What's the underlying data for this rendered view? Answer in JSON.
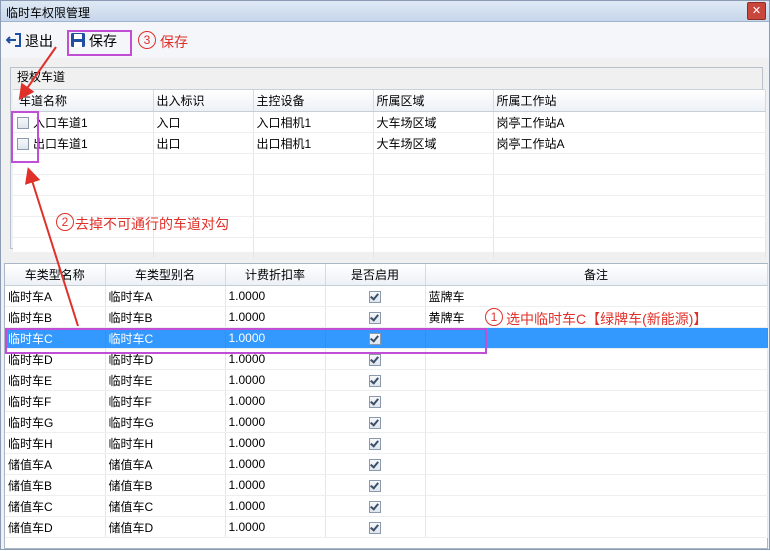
{
  "window": {
    "title": "临时车权限管理",
    "close_label": "✕"
  },
  "toolbar": {
    "exit_label": "退出",
    "save_label": "保存"
  },
  "annotations": {
    "step1_num": "1",
    "step1_text": "选中临时车C【绿牌车(新能源)】",
    "step2_num": "2",
    "step2_text": "去掉不可通行的车道对勾",
    "step3_num": "3",
    "step3_text": "保存"
  },
  "lanes": {
    "group_title": "授权车道",
    "columns": [
      "车道名称",
      "出入标识",
      "主控设备",
      "所属区域",
      "所属工作站"
    ],
    "rows": [
      {
        "checked": false,
        "name": "入口车道1",
        "direction": "入口",
        "device": "入口相机1",
        "area": "大车场区域",
        "station": "岗亭工作站A"
      },
      {
        "checked": false,
        "name": "出口车道1",
        "direction": "出口",
        "device": "出口相机1",
        "area": "大车场区域",
        "station": "岗亭工作站A"
      }
    ]
  },
  "car_types": {
    "columns": [
      "车类型名称",
      "车类型别名",
      "计费折扣率",
      "是否启用",
      "备注"
    ],
    "selected_index": 2,
    "rows": [
      {
        "name": "临时车A",
        "alias": "临时车A",
        "rate": "1.0000",
        "enabled": true,
        "note": "蓝牌车"
      },
      {
        "name": "临时车B",
        "alias": "临时车B",
        "rate": "1.0000",
        "enabled": true,
        "note": "黄牌车"
      },
      {
        "name": "临时车C",
        "alias": "临时车C",
        "rate": "1.0000",
        "enabled": true,
        "note": ""
      },
      {
        "name": "临时车D",
        "alias": "临时车D",
        "rate": "1.0000",
        "enabled": true,
        "note": ""
      },
      {
        "name": "临时车E",
        "alias": "临时车E",
        "rate": "1.0000",
        "enabled": true,
        "note": ""
      },
      {
        "name": "临时车F",
        "alias": "临时车F",
        "rate": "1.0000",
        "enabled": true,
        "note": ""
      },
      {
        "name": "临时车G",
        "alias": "临时车G",
        "rate": "1.0000",
        "enabled": true,
        "note": ""
      },
      {
        "name": "临时车H",
        "alias": "临时车H",
        "rate": "1.0000",
        "enabled": true,
        "note": ""
      },
      {
        "name": "储值车A",
        "alias": "储值车A",
        "rate": "1.0000",
        "enabled": true,
        "note": ""
      },
      {
        "name": "储值车B",
        "alias": "储值车B",
        "rate": "1.0000",
        "enabled": true,
        "note": ""
      },
      {
        "name": "储值车C",
        "alias": "储值车C",
        "rate": "1.0000",
        "enabled": true,
        "note": ""
      },
      {
        "name": "储值车D",
        "alias": "储值车D",
        "rate": "1.0000",
        "enabled": true,
        "note": ""
      }
    ]
  },
  "colors": {
    "annotation": "#e0302a",
    "highlight": "#c14fd6",
    "selection": "#3399ff"
  }
}
